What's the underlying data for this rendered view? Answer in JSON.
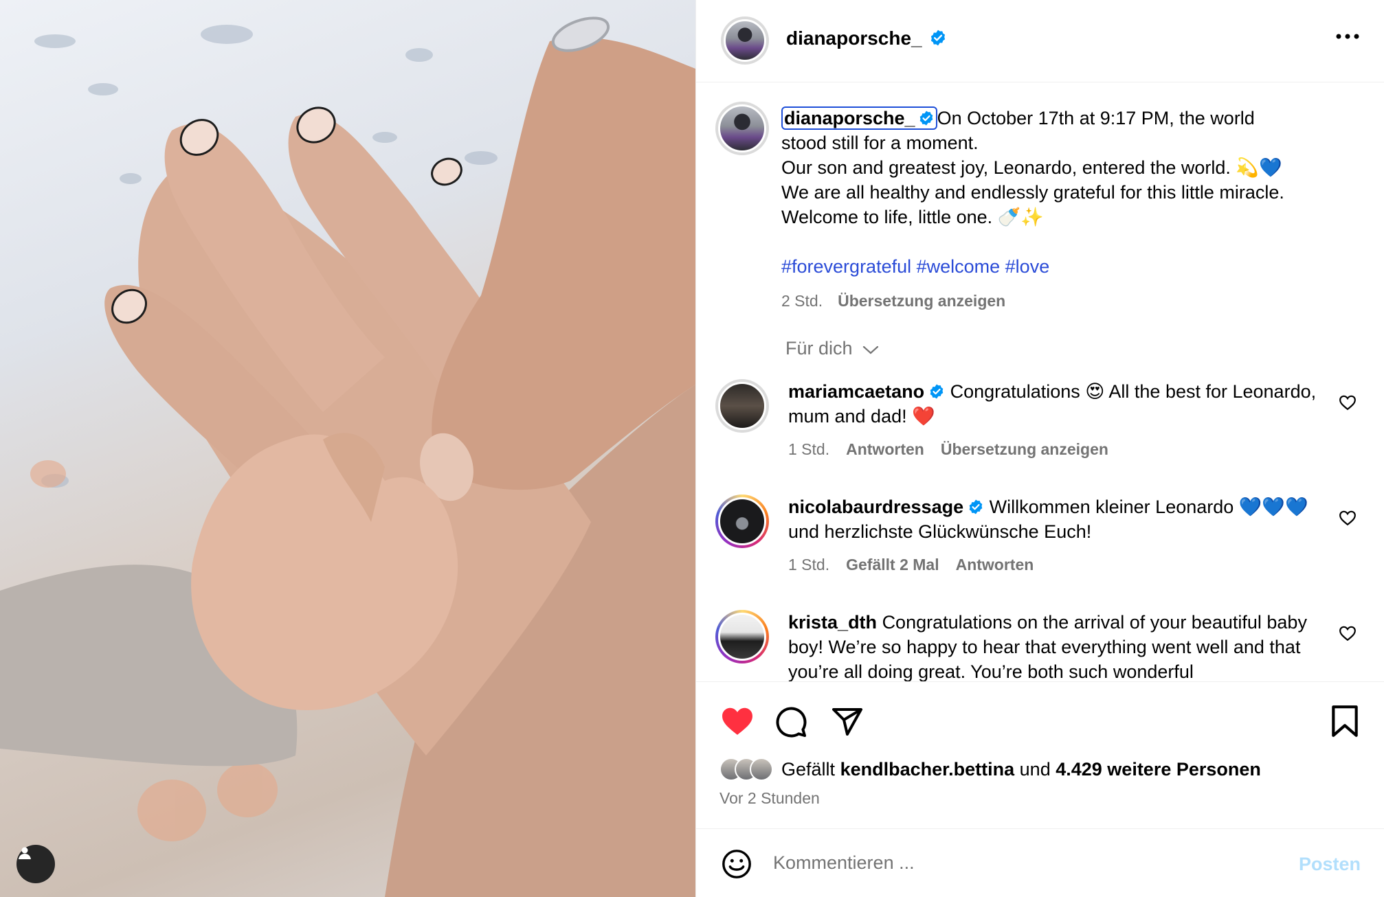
{
  "post": {
    "author": "dianaporsche_",
    "caption_lines": [
      "On October 17th at 9:17 PM, the world",
      "stood still for a moment.",
      "Our son and greatest joy, Leonardo, entered the world. 💫💙",
      "We are all healthy and endlessly grateful for this little miracle.",
      "Welcome to life, little one. 🍼✨"
    ],
    "hashtags": "#forevergrateful #welcome #love",
    "time": "2 Std.",
    "translate_label": "Übersetzung anzeigen"
  },
  "filter_label": "Für dich",
  "comments": [
    {
      "user": "mariamcaetano",
      "verified": true,
      "text": "Congratulations 😍 All the best for Leonardo, mum and dad! ❤️",
      "time": "1 Std.",
      "actions": [
        "Antworten",
        "Übersetzung anzeigen"
      ]
    },
    {
      "user": "nicolabaurdressage",
      "verified": true,
      "text": "Willkommen kleiner Leonardo 💙💙💙 und herzlichste Glückwünsche Euch!",
      "time": "1 Std.",
      "actions": [
        "Gefällt 2 Mal",
        "Antworten"
      ]
    },
    {
      "user": "krista_dth",
      "verified": false,
      "text": "Congratulations on the arrival of your beautiful baby boy! We’re so happy to hear that everything went well and that you’re all doing great. You’re both such wonderful"
    }
  ],
  "likes": {
    "prefix": "Gefällt",
    "liker": "kendlbacher.bettina",
    "connector": "und",
    "others": "4.429 weitere Personen",
    "ago": "Vor 2 Stunden"
  },
  "composer": {
    "placeholder": "Kommentieren ...",
    "post_label": "Posten"
  },
  "colors": {
    "like_red": "#ff3040",
    "verified_blue": "#0095f6",
    "hashtag_blue": "#2a4bd7",
    "muted_gray": "#737373"
  },
  "icons": [
    "user-tag-icon",
    "verified-icon",
    "more-icon",
    "chevron-down-icon",
    "heart-icon",
    "comment-icon",
    "share-icon",
    "bookmark-icon",
    "emoji-icon"
  ]
}
